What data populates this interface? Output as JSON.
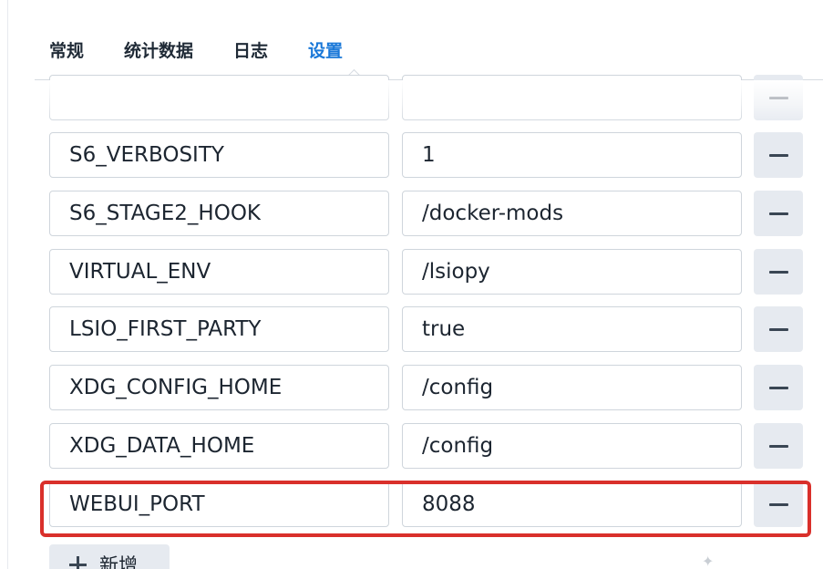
{
  "tabs": [
    {
      "label": "常规",
      "active": false
    },
    {
      "label": "统计数据",
      "active": false
    },
    {
      "label": "日志",
      "active": false
    },
    {
      "label": "设置",
      "active": true
    }
  ],
  "env_vars": [
    {
      "key": "",
      "value": ""
    },
    {
      "key": "S6_VERBOSITY",
      "value": "1"
    },
    {
      "key": "S6_STAGE2_HOOK",
      "value": "/docker-mods"
    },
    {
      "key": "VIRTUAL_ENV",
      "value": "/lsiopy"
    },
    {
      "key": "LSIO_FIRST_PARTY",
      "value": "true"
    },
    {
      "key": "XDG_CONFIG_HOME",
      "value": "/config"
    },
    {
      "key": "XDG_DATA_HOME",
      "value": "/config"
    },
    {
      "key": "WEBUI_PORT",
      "value": "8088"
    }
  ],
  "add_button": {
    "label": "新增"
  },
  "icons": {
    "remove": "minus-icon",
    "add": "plus-icon"
  },
  "colors": {
    "accent": "#1a78d8",
    "highlight": "#d9302b",
    "button_bg": "#e6eaf0",
    "border": "#cfd5dc"
  }
}
